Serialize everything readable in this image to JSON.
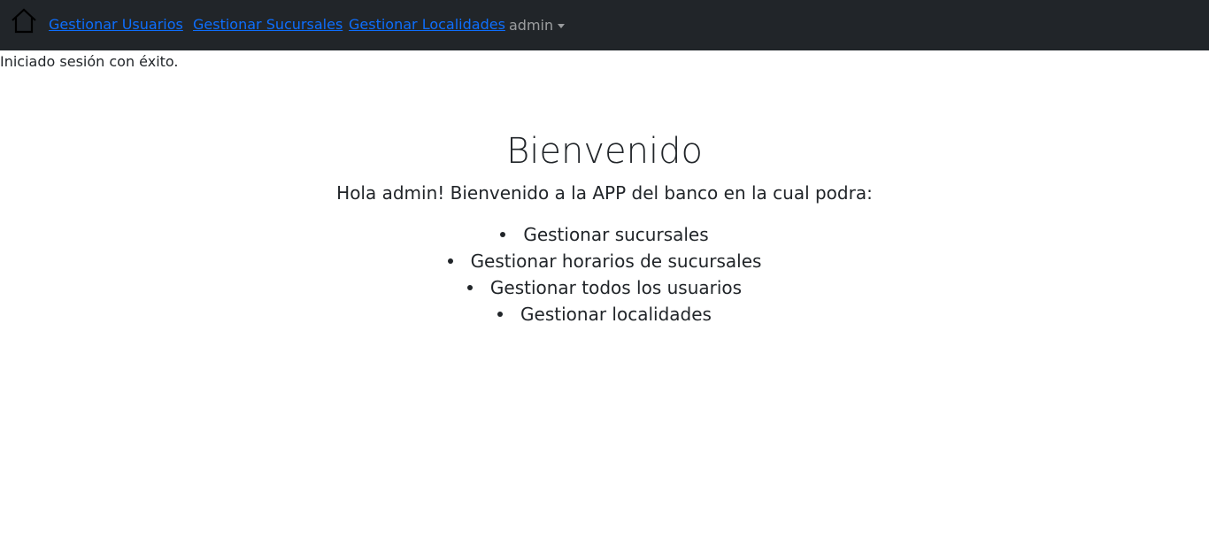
{
  "navbar": {
    "home_icon": "home-icon",
    "links": [
      {
        "label": "Gestionar Usuarios"
      },
      {
        "label": "Gestionar Sucursales"
      },
      {
        "label": "Gestionar Localidades"
      }
    ],
    "user_menu_label": "admin",
    "colors": {
      "background": "#212529",
      "link": "#0d6efd"
    }
  },
  "alert": {
    "message": "Iniciado sesión con éxito."
  },
  "main": {
    "title": "Bienvenido",
    "intro": "Hola admin! Bienvenido a la APP del banco en la cual podra:",
    "features": [
      "Gestionar sucursales",
      "Gestionar horarios de sucursales",
      "Gestionar todos los usuarios",
      "Gestionar localidades"
    ]
  }
}
